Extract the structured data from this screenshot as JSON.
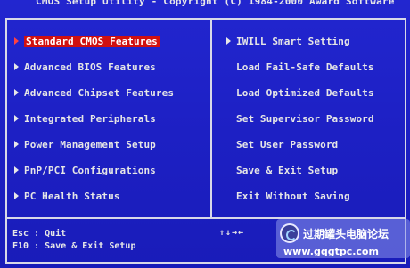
{
  "title": "CMOS Setup Utility - Copyright (C) 1984-2000 Award Software",
  "menu": {
    "left": [
      {
        "label": "Standard CMOS Features",
        "selected": true
      },
      {
        "label": "Advanced BIOS Features",
        "selected": false
      },
      {
        "label": "Advanced Chipset Features",
        "selected": false
      },
      {
        "label": "Integrated Peripherals",
        "selected": false
      },
      {
        "label": "Power Management Setup",
        "selected": false
      },
      {
        "label": "PnP/PCI Configurations",
        "selected": false
      },
      {
        "label": "PC Health Status",
        "selected": false
      }
    ],
    "right": [
      {
        "label": "IWILL Smart Setting",
        "has_arrow": true
      },
      {
        "label": "Load Fail-Safe Defaults",
        "has_arrow": false
      },
      {
        "label": "Load Optimized Defaults",
        "has_arrow": false
      },
      {
        "label": "Set Supervisor Password",
        "has_arrow": false
      },
      {
        "label": "Set User Password",
        "has_arrow": false
      },
      {
        "label": "Save & Exit Setup",
        "has_arrow": false
      },
      {
        "label": "Exit Without Saving",
        "has_arrow": false
      }
    ]
  },
  "footer": {
    "esc": "Esc : Quit",
    "f10": "F10 : Save & Exit Setup",
    "nav": "↑↓→←"
  },
  "watermark": {
    "text": "过期罐头电脑论坛",
    "url": "www.gqgtpc.com"
  },
  "colors": {
    "background": "#1d20c4",
    "text": "#e6e6e6",
    "highlight": "#d01010",
    "border": "#d8d8e8"
  }
}
